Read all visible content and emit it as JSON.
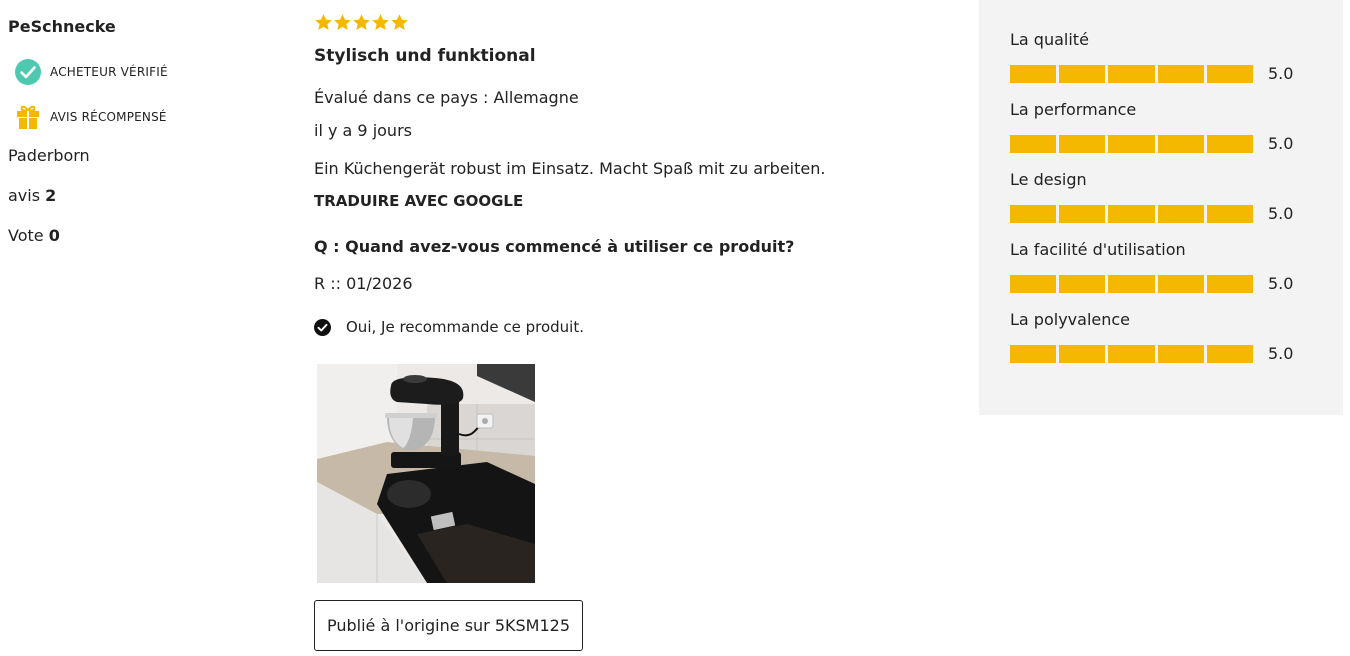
{
  "author": {
    "name": "PeSchnecke",
    "badges": [
      {
        "label": "ACHETEUR VÉRIFIÉ",
        "icon": "check-circle-icon",
        "color": "#4ec9b0"
      },
      {
        "label": "AVIS RÉCOMPENSÉ",
        "icon": "gift-icon",
        "color": "#f5b800"
      }
    ],
    "location": "Paderborn",
    "reviews_label": "avis",
    "reviews_count": "2",
    "votes_label": "Vote",
    "votes_count": "0"
  },
  "review": {
    "stars": 5,
    "star_color": "#f5b800",
    "title": "Stylisch und funktional",
    "country": "Évalué dans ce pays : Allemagne",
    "age": "il y a 9 jours",
    "text": "Ein Küchengerät robust im Einsatz. Macht Spaß mit zu arbeiten.",
    "translate_label": "TRADUIRE AVEC GOOGLE",
    "question": "Q : Quand avez-vous commencé à utiliser ce produit?",
    "answer": "R :: 01/2026",
    "recommend_text": "Oui, Je recommande ce produit.",
    "recommend_icon": "check-circle-icon",
    "photo_alt": "stand-mixer-photo",
    "origin_button": "Publié à l'origine sur 5KSM125"
  },
  "ratings": {
    "bar_color": "#f5b800",
    "panel_color": "#f3f3f3",
    "segments": 5,
    "items": [
      {
        "label": "La qualité",
        "value": "5.0",
        "score": 5
      },
      {
        "label": "La performance",
        "value": "5.0",
        "score": 5
      },
      {
        "label": "Le design",
        "value": "5.0",
        "score": 5
      },
      {
        "label": "La facilité d'utilisation",
        "value": "5.0",
        "score": 5
      },
      {
        "label": "La polyvalence",
        "value": "5.0",
        "score": 5
      }
    ]
  }
}
